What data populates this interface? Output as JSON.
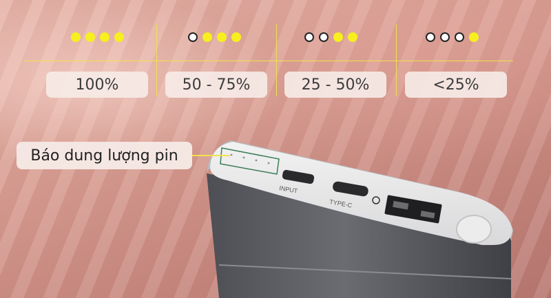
{
  "levels": [
    {
      "label": "100%",
      "lit": 4
    },
    {
      "label": "50 - 75%",
      "lit": 3
    },
    {
      "label": "25 - 50%",
      "lit": 2
    },
    {
      "label": "<25%",
      "lit": 1
    }
  ],
  "callout": {
    "label": "Báo dung lượng pin"
  },
  "ports": {
    "input": "INPUT",
    "type_c": "TYPE-C"
  },
  "colors": {
    "led_on": "#f7ef1f",
    "line": "#f2e24a",
    "pill_bg": "#f6eae6"
  }
}
